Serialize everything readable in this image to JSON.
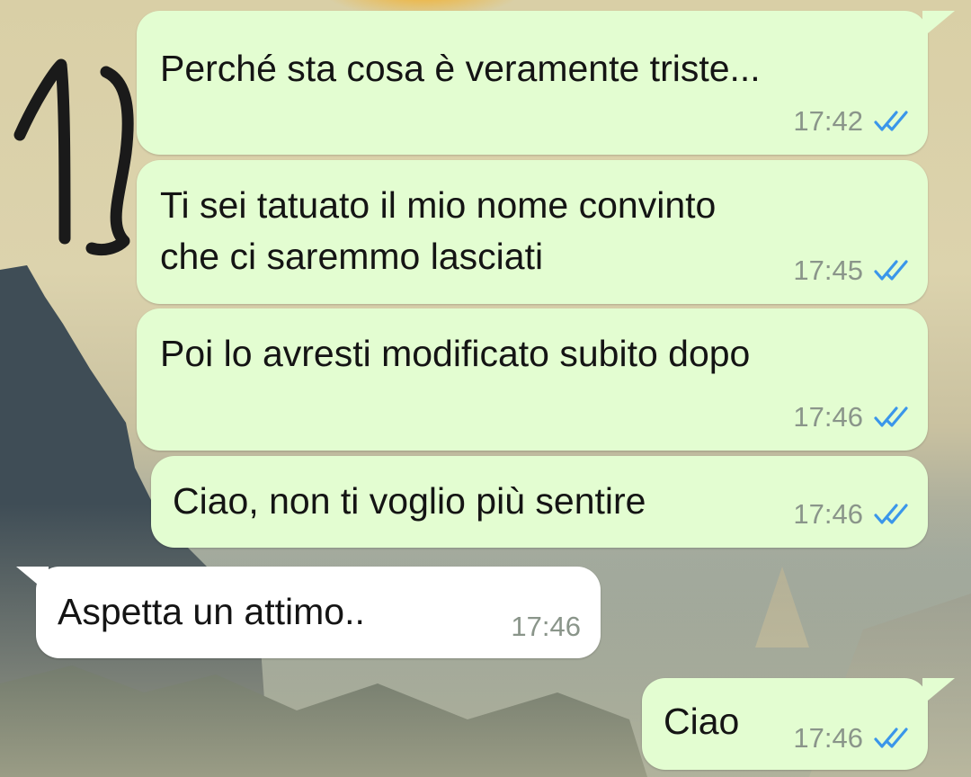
{
  "colors": {
    "outgoing_bubble": "#e3fdd1",
    "incoming_bubble": "#ffffff",
    "read_ticks": "#3a96ea",
    "timestamp": "#8a958a",
    "text": "#141414"
  },
  "icons": {
    "read_receipt": "double-check-icon"
  },
  "messages": [
    {
      "direction": "out",
      "text": [
        "Perché sta cosa è veramente triste..."
      ],
      "time": "17:42",
      "status": "read"
    },
    {
      "direction": "out",
      "text": [
        "Ti sei tatuato il mio nome convinto",
        "che ci saremmo lasciati"
      ],
      "time": "17:45",
      "status": "read"
    },
    {
      "direction": "out",
      "text": [
        "Poi lo avresti modificato subito dopo"
      ],
      "time": "17:46",
      "status": "read"
    },
    {
      "direction": "out",
      "text": [
        "Ciao, non ti voglio più sentire"
      ],
      "time": "17:46",
      "status": "read"
    },
    {
      "direction": "in",
      "text": [
        "Aspetta un attimo.."
      ],
      "time": "17:46"
    },
    {
      "direction": "out",
      "text": [
        "Ciao"
      ],
      "time": "17:46",
      "status": "read"
    }
  ]
}
